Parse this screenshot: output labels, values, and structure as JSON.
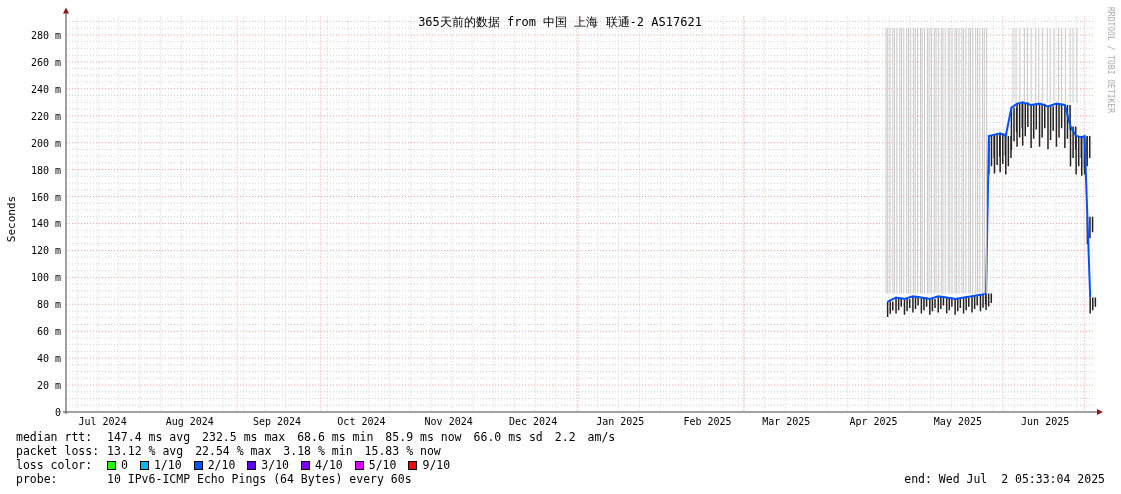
{
  "graph": {
    "watermark": "RRDTOOL / TOBI OETIKER",
    "chart_data": {
      "type": "line",
      "title": "365天前的数据 from 中国 上海 联通-2 AS17621",
      "ylabel": "Seconds",
      "grid": true,
      "xlim": [
        "2024-07-02",
        "2025-07-02"
      ],
      "ylim": [
        0,
        290
      ],
      "yticks": [
        {
          "value": 0,
          "label": "0"
        },
        {
          "value": 20,
          "label": "20 m"
        },
        {
          "value": 40,
          "label": "40 m"
        },
        {
          "value": 60,
          "label": "60 m"
        },
        {
          "value": 80,
          "label": "80 m"
        },
        {
          "value": 100,
          "label": "100 m"
        },
        {
          "value": 120,
          "label": "120 m"
        },
        {
          "value": 140,
          "label": "140 m"
        },
        {
          "value": 160,
          "label": "160 m"
        },
        {
          "value": 180,
          "label": "180 m"
        },
        {
          "value": 200,
          "label": "200 m"
        },
        {
          "value": 220,
          "label": "220 m"
        },
        {
          "value": 240,
          "label": "240 m"
        },
        {
          "value": 260,
          "label": "260 m"
        },
        {
          "value": 280,
          "label": "280 m"
        }
      ],
      "xticks": [
        {
          "value": "2024-07-15",
          "label": "Jul 2024"
        },
        {
          "value": "2024-08-15",
          "label": "Aug 2024"
        },
        {
          "value": "2024-09-15",
          "label": "Sep 2024"
        },
        {
          "value": "2024-10-15",
          "label": "Oct 2024"
        },
        {
          "value": "2024-11-15",
          "label": "Nov 2024"
        },
        {
          "value": "2024-12-15",
          "label": "Dec 2024"
        },
        {
          "value": "2025-01-15",
          "label": "Jan 2025"
        },
        {
          "value": "2025-02-15",
          "label": "Feb 2025"
        },
        {
          "value": "2025-03-15",
          "label": "Mar 2025"
        },
        {
          "value": "2025-04-15",
          "label": "Apr 2025"
        },
        {
          "value": "2025-05-15",
          "label": "May 2025"
        },
        {
          "value": "2025-06-15",
          "label": "Jun 2025"
        }
      ],
      "x": [
        "2025-04-20",
        "2025-04-23",
        "2025-04-26",
        "2025-04-29",
        "2025-05-02",
        "2025-05-05",
        "2025-05-08",
        "2025-05-11",
        "2025-05-14",
        "2025-05-17",
        "2025-05-20",
        "2025-05-23",
        "2025-05-25",
        "2025-05-26",
        "2025-05-28",
        "2025-05-30",
        "2025-06-01",
        "2025-06-03",
        "2025-06-05",
        "2025-06-07",
        "2025-06-10",
        "2025-06-13",
        "2025-06-16",
        "2025-06-19",
        "2025-06-22",
        "2025-06-24",
        "2025-06-26",
        "2025-06-28",
        "2025-06-29",
        "2025-06-30",
        "2025-07-01"
      ],
      "series": [
        {
          "name": "median rtt:",
          "color": "#0050ff",
          "values": [
            82,
            85,
            84,
            86,
            85,
            84,
            86,
            85,
            84,
            85,
            86,
            87,
            88,
            205,
            206,
            207,
            205,
            226,
            229,
            230,
            228,
            229,
            227,
            229,
            228,
            212,
            205,
            204,
            205,
            145,
            85
          ]
        }
      ]
    }
  },
  "legend": {
    "rows": [
      {
        "items": [
          "147.4 ms avg",
          "232.5 ms max",
          "68.6 ms min",
          "85.9 ms now",
          "66.0 ms sd",
          "2.2",
          "am/s"
        ]
      },
      {
        "label": "packet loss:",
        "items": [
          "13.12 % avg",
          "22.54 % max",
          "3.18 % min",
          "15.83 % now"
        ]
      }
    ],
    "loss_color": {
      "label": "loss color:",
      "items": [
        {
          "label": "0",
          "color": "#26ff00"
        },
        {
          "label": "1/10",
          "color": "#00b8ff"
        },
        {
          "label": "2/10",
          "color": "#0059ff"
        },
        {
          "label": "3/10",
          "color": "#5e00ff"
        },
        {
          "label": "4/10",
          "color": "#7e00ff"
        },
        {
          "label": "5/10",
          "color": "#dd00ff"
        },
        {
          "label": "9/10",
          "color": "#ff0000"
        }
      ]
    },
    "probe": {
      "label": "probe:",
      "text": "10 IPv6-ICMP Echo Pings (64 Bytes) every 60s"
    },
    "end": "end: Wed Jul  2 05:33:04 2025"
  }
}
